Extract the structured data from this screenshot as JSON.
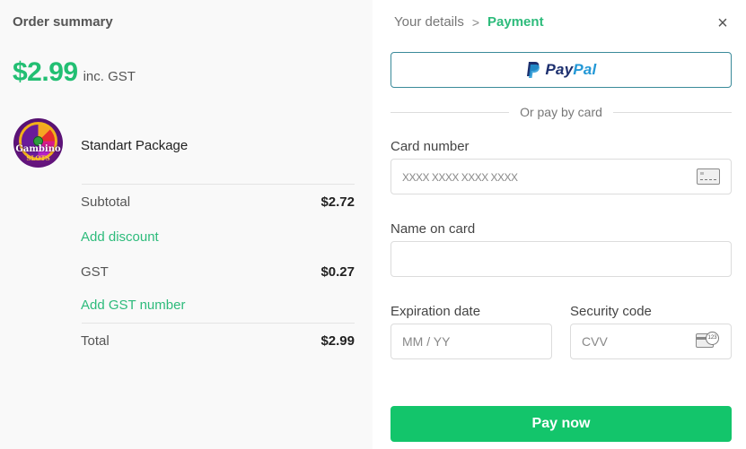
{
  "order_summary": {
    "title": "Order summary",
    "price": "$2.99",
    "price_suffix": "inc. GST",
    "product": {
      "name": "Standart Package",
      "logo_line1": "Gambino",
      "logo_line2": "SLOTS"
    },
    "subtotal_label": "Subtotal",
    "subtotal_value": "$2.72",
    "add_discount": "Add discount",
    "gst_label": "GST",
    "gst_value": "$0.27",
    "add_gst_number": "Add GST number",
    "total_label": "Total",
    "total_value": "$2.99"
  },
  "payment": {
    "breadcrumb": {
      "previous": "Your details",
      "separator": ">",
      "current": "Payment"
    },
    "close_symbol": "×",
    "paypal": {
      "word_dark": "Pay",
      "word_light": "Pal"
    },
    "or_text": "Or pay by card",
    "card_number": {
      "label": "Card number",
      "placeholder": "XXXX XXXX XXXX XXXX",
      "value": ""
    },
    "name_on_card": {
      "label": "Name on card",
      "placeholder": "",
      "value": ""
    },
    "expiration": {
      "label": "Expiration date",
      "placeholder": "MM / YY",
      "value": ""
    },
    "security_code": {
      "label": "Security code",
      "placeholder": "CVV",
      "value": "",
      "icon_text": "123"
    },
    "pay_button": "Pay now"
  },
  "colors": {
    "accent_green": "#22bf73",
    "pay_button": "#13c56b",
    "paypal_dark": "#1c2f6e",
    "paypal_light": "#2398d6"
  }
}
